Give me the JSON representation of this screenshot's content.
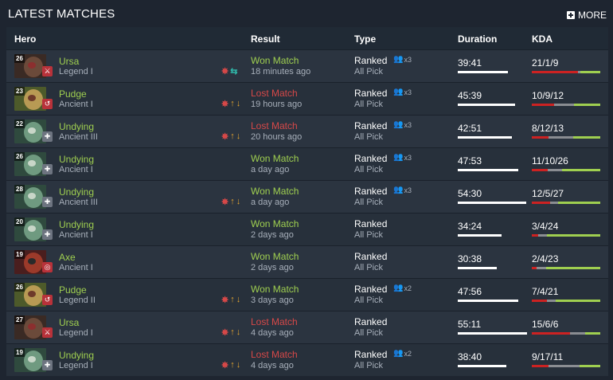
{
  "header": {
    "title": "LATEST MATCHES",
    "more_label": "MORE"
  },
  "columns": {
    "hero": "Hero",
    "result": "Result",
    "type": "Type",
    "duration": "Duration",
    "kda": "KDA"
  },
  "colors": {
    "win": "#9fcf50",
    "loss": "#d64848",
    "kills": "#cc2222",
    "deaths": "#8a8d92",
    "assists": "#9fcf50"
  },
  "matches": [
    {
      "level": "26",
      "hero": "Ursa",
      "rank": "Legend I",
      "role_icon": "sword-icon",
      "role_color": "red",
      "icons": [
        "party-icon",
        "swap-icon"
      ],
      "result": "Won Match",
      "outcome": "win",
      "time": "18 minutes ago",
      "type": "Ranked",
      "party": "x3",
      "mode": "All Pick",
      "duration": "39:41",
      "duration_frac": 0.72,
      "kda": "21/1/9",
      "k": 21,
      "d": 1,
      "a": 9
    },
    {
      "level": "23",
      "hero": "Pudge",
      "rank": "Ancient I",
      "role_icon": "hook-icon",
      "role_color": "red",
      "icons": [
        "party-icon",
        "rank-up-icon",
        "rank-down-icon"
      ],
      "result": "Lost Match",
      "outcome": "loss",
      "time": "19 hours ago",
      "type": "Ranked",
      "party": "x3",
      "mode": "All Pick",
      "duration": "45:39",
      "duration_frac": 0.83,
      "kda": "10/9/12",
      "k": 10,
      "d": 9,
      "a": 12
    },
    {
      "level": "22",
      "hero": "Undying",
      "rank": "Ancient III",
      "role_icon": "support-icon",
      "role_color": "gray",
      "icons": [
        "party-icon",
        "rank-up-icon",
        "rank-down-icon"
      ],
      "result": "Lost Match",
      "outcome": "loss",
      "time": "20 hours ago",
      "type": "Ranked",
      "party": "x3",
      "mode": "All Pick",
      "duration": "42:51",
      "duration_frac": 0.78,
      "kda": "8/12/13",
      "k": 8,
      "d": 12,
      "a": 13
    },
    {
      "level": "26",
      "hero": "Undying",
      "rank": "Ancient I",
      "role_icon": "support-icon",
      "role_color": "gray",
      "icons": [],
      "result": "Won Match",
      "outcome": "win",
      "time": "a day ago",
      "type": "Ranked",
      "party": "x3",
      "mode": "All Pick",
      "duration": "47:53",
      "duration_frac": 0.87,
      "kda": "11/10/26",
      "k": 11,
      "d": 10,
      "a": 26
    },
    {
      "level": "28",
      "hero": "Undying",
      "rank": "Ancient III",
      "role_icon": "support-icon",
      "role_color": "gray",
      "icons": [
        "party-icon",
        "rank-up-icon",
        "rank-down-icon"
      ],
      "result": "Won Match",
      "outcome": "win",
      "time": "a day ago",
      "type": "Ranked",
      "party": "x3",
      "mode": "All Pick",
      "duration": "54:30",
      "duration_frac": 0.99,
      "kda": "12/5/27",
      "k": 12,
      "d": 5,
      "a": 27
    },
    {
      "level": "20",
      "hero": "Undying",
      "rank": "Ancient I",
      "role_icon": "support-icon",
      "role_color": "gray",
      "icons": [],
      "result": "Won Match",
      "outcome": "win",
      "time": "2 days ago",
      "type": "Ranked",
      "party": "",
      "mode": "All Pick",
      "duration": "34:24",
      "duration_frac": 0.63,
      "kda": "3/4/24",
      "k": 3,
      "d": 4,
      "a": 24
    },
    {
      "level": "19",
      "hero": "Axe",
      "rank": "Ancient I",
      "role_icon": "shield-icon",
      "role_color": "red",
      "icons": [],
      "result": "Won Match",
      "outcome": "win",
      "time": "2 days ago",
      "type": "Ranked",
      "party": "",
      "mode": "All Pick",
      "duration": "30:38",
      "duration_frac": 0.56,
      "kda": "2/4/23",
      "k": 2,
      "d": 4,
      "a": 23
    },
    {
      "level": "26",
      "hero": "Pudge",
      "rank": "Legend II",
      "role_icon": "hook-icon",
      "role_color": "red",
      "icons": [
        "party-icon",
        "rank-up-icon",
        "rank-down-icon"
      ],
      "result": "Won Match",
      "outcome": "win",
      "time": "3 days ago",
      "type": "Ranked",
      "party": "x2",
      "mode": "All Pick",
      "duration": "47:56",
      "duration_frac": 0.87,
      "kda": "7/4/21",
      "k": 7,
      "d": 4,
      "a": 21
    },
    {
      "level": "27",
      "hero": "Ursa",
      "rank": "Legend I",
      "role_icon": "sword-icon",
      "role_color": "red",
      "icons": [
        "party-icon",
        "rank-up-icon",
        "rank-down-icon"
      ],
      "result": "Lost Match",
      "outcome": "loss",
      "time": "4 days ago",
      "type": "Ranked",
      "party": "",
      "mode": "All Pick",
      "duration": "55:11",
      "duration_frac": 1.0,
      "kda": "15/6/6",
      "k": 15,
      "d": 6,
      "a": 6
    },
    {
      "level": "19",
      "hero": "Undying",
      "rank": "Legend I",
      "role_icon": "support-icon",
      "role_color": "gray",
      "icons": [
        "party-icon",
        "rank-up-icon",
        "rank-down-icon"
      ],
      "result": "Lost Match",
      "outcome": "loss",
      "time": "4 days ago",
      "type": "Ranked",
      "party": "x2",
      "mode": "All Pick",
      "duration": "38:40",
      "duration_frac": 0.7,
      "kda": "9/17/11",
      "k": 9,
      "d": 17,
      "a": 11
    }
  ]
}
